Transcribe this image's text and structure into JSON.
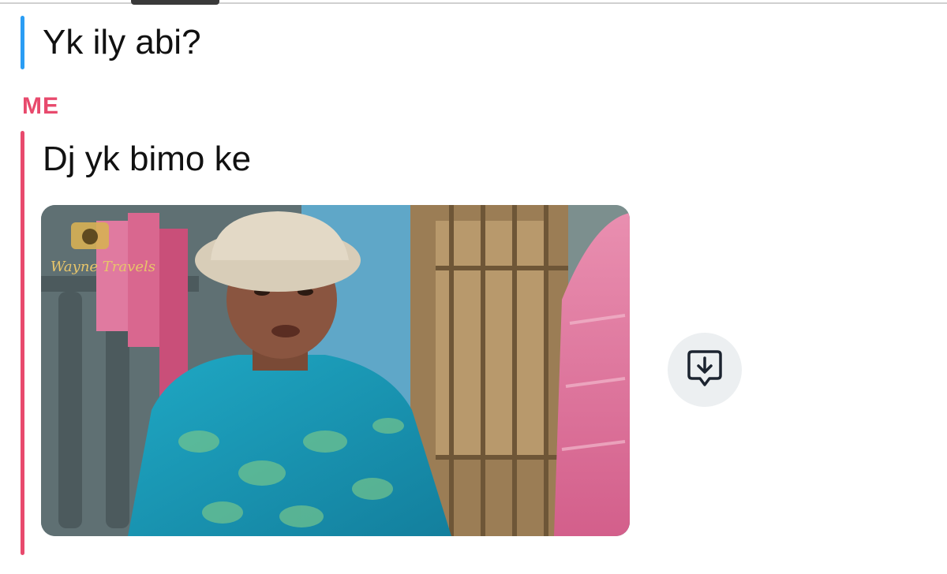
{
  "conversation": {
    "friend_message": {
      "text": "Yk ily abi?",
      "accent_color": "#2a9df4"
    },
    "my_message": {
      "sender_label": "ME",
      "text": "Dj yk bimo ke",
      "accent_color": "#e84a6d",
      "attachment": {
        "type": "gif",
        "watermark": "Wayne Travels"
      }
    }
  },
  "actions": {
    "save_icon": "save-to-chat-icon"
  }
}
